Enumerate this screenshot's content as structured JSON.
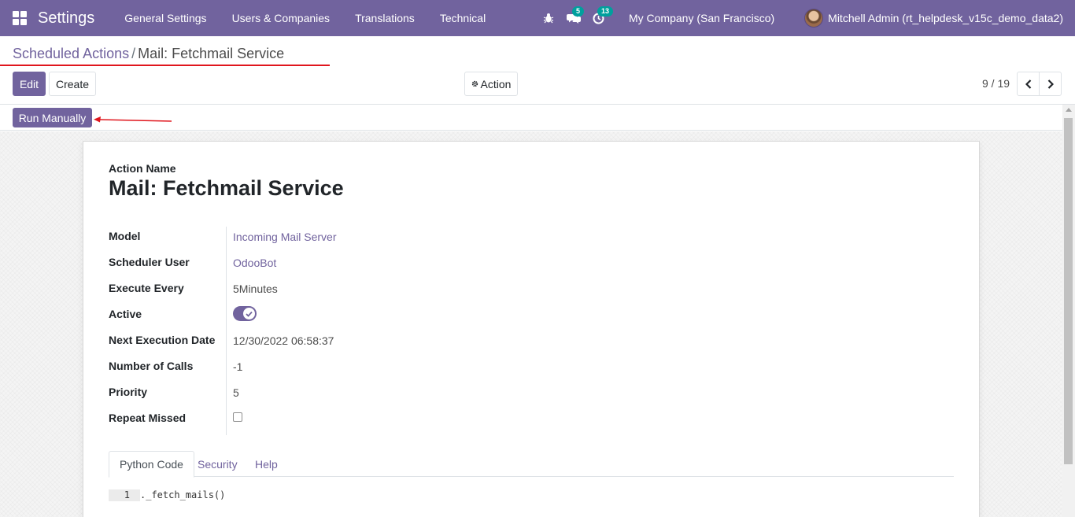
{
  "navbar": {
    "app_name": "Settings",
    "menu": [
      "General Settings",
      "Users & Companies",
      "Translations",
      "Technical"
    ],
    "messages_count": "5",
    "activities_count": "13",
    "company": "My Company (San Francisco)",
    "user": "Mitchell Admin (rt_helpdesk_v15c_demo_data2)"
  },
  "breadcrumb": {
    "parent": "Scheduled Actions",
    "separator": "/",
    "current": "Mail: Fetchmail Service"
  },
  "control_panel": {
    "edit_label": "Edit",
    "create_label": "Create",
    "action_label": "Action",
    "pager": "9 / 19"
  },
  "statusbar": {
    "run_manually_label": "Run Manually"
  },
  "form": {
    "name_label": "Action Name",
    "title": "Mail: Fetchmail Service",
    "fields": {
      "model": {
        "label": "Model",
        "value": "Incoming Mail Server"
      },
      "scheduler_user": {
        "label": "Scheduler User",
        "value": "OdooBot"
      },
      "execute_every": {
        "label": "Execute Every",
        "value": "5Minutes"
      },
      "active": {
        "label": "Active",
        "checked": true
      },
      "next_execution": {
        "label": "Next Execution Date",
        "value": "12/30/2022 06:58:37"
      },
      "number_of_calls": {
        "label": "Number of Calls",
        "value": "-1"
      },
      "priority": {
        "label": "Priority",
        "value": "5"
      },
      "repeat_missed": {
        "label": "Repeat Missed",
        "checked": false
      }
    },
    "tabs": [
      "Python Code",
      "Security",
      "Help"
    ],
    "active_tab": "Python Code",
    "code": {
      "line_number": "1",
      "text": "._fetch_mails()"
    }
  },
  "colors": {
    "brand": "#71639e",
    "badge": "#00a09d",
    "annotation": "#e0161d"
  }
}
